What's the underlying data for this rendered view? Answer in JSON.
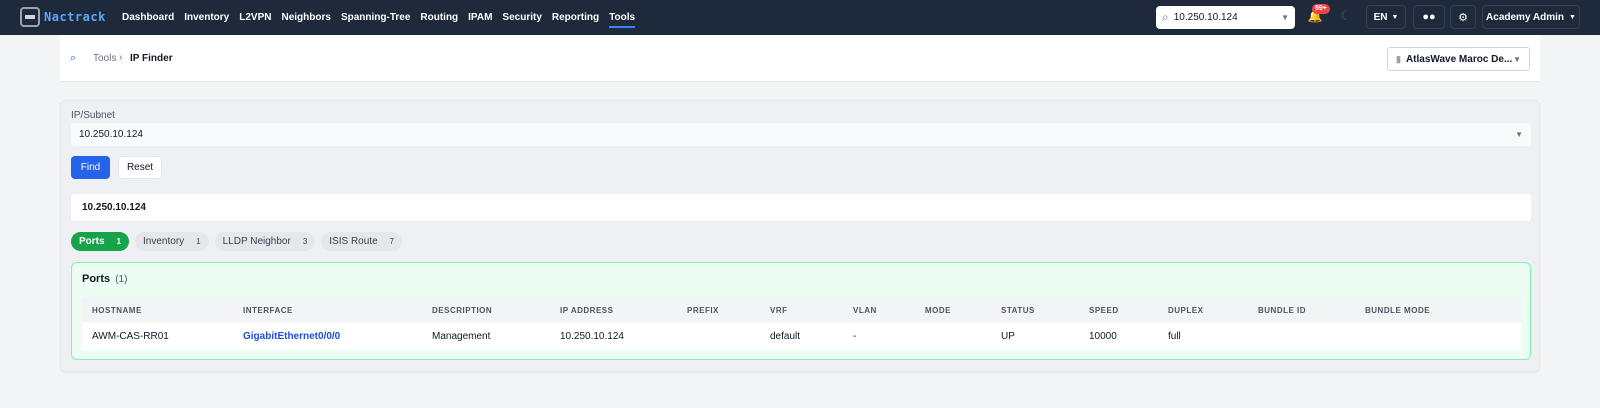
{
  "app": {
    "logo_text": "Nactrack"
  },
  "nav": {
    "items": [
      "Dashboard",
      "Inventory",
      "L2VPN",
      "Neighbors",
      "Spanning-Tree",
      "Routing",
      "IPAM",
      "Security",
      "Reporting",
      "Tools"
    ],
    "active": "Tools"
  },
  "topbar": {
    "search_value": "10.250.10.124",
    "notifications_badge": "99+",
    "language": "EN",
    "user": "Academy Admin"
  },
  "breadcrumb": {
    "parent": "Tools",
    "current": "IP Finder"
  },
  "tenant": {
    "label": "AtlasWave Maroc De..."
  },
  "form": {
    "ip_label": "IP/Subnet",
    "ip_value": "10.250.10.124",
    "find_label": "Find",
    "reset_label": "Reset"
  },
  "query": {
    "value": "10.250.10.124"
  },
  "tabs": [
    {
      "label": "Ports",
      "count": "1",
      "active": true
    },
    {
      "label": "Inventory",
      "count": "1",
      "active": false
    },
    {
      "label": "LLDP Neighbor",
      "count": "3",
      "active": false
    },
    {
      "label": "ISIS Route",
      "count": "7",
      "active": false
    }
  ],
  "results": {
    "title": "Ports",
    "count_text": "(1)",
    "columns": [
      "HOSTNAME",
      "INTERFACE",
      "DESCRIPTION",
      "IP ADDRESS",
      "PREFIX",
      "VRF",
      "VLAN",
      "MODE",
      "STATUS",
      "SPEED",
      "DUPLEX",
      "BUNDLE ID",
      "BUNDLE MODE"
    ],
    "rows": [
      [
        "AWM-CAS-RR01",
        "GigabitEthernet0/0/0",
        "Management",
        "10.250.10.124",
        "",
        "default",
        "-",
        "",
        "UP",
        "10000",
        "full",
        "",
        ""
      ]
    ]
  },
  "colors": {
    "topbar": "#1e2a3b",
    "primary": "#2563eb",
    "active_tab": "#16a34a",
    "results_bg": "#ecfdf3",
    "results_border": "#86efac"
  }
}
